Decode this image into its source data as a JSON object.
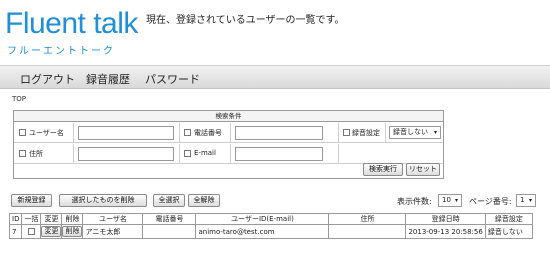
{
  "header": {
    "logo_main": "Fluent talk",
    "logo_sub": "フルーエントトーク",
    "description": "現在、登録されているユーザーの一覧です。"
  },
  "nav": {
    "logout": "ログアウト",
    "history": "録音履歴",
    "password": "パスワード"
  },
  "breadcrumb": "TOP",
  "search": {
    "title": "検索条件",
    "username_label": "ユーザー名",
    "phone_label": "電話番号",
    "recording_label": "録音設定",
    "recording_value": "録音しない",
    "address_label": "住所",
    "email_label": "E-mail",
    "search_button": "検索実行",
    "reset_button": "リセット"
  },
  "toolbar": {
    "new_button": "新規登録",
    "delete_selected_button": "選択したものを削除",
    "select_all_button": "全選択",
    "deselect_all_button": "全解除",
    "per_page_label": "表示件数:",
    "per_page_value": "10",
    "page_label": "ページ番号:",
    "page_value": "1"
  },
  "table": {
    "headers": {
      "id": "ID",
      "bulk": "一括",
      "edit": "変更",
      "delete": "削除",
      "username": "ユーザ名",
      "phone": "電話番号",
      "userid": "ユーザーID(E-mail)",
      "address": "住所",
      "registered": "登録日時",
      "recording": "録音設定"
    },
    "rows": [
      {
        "id": "7",
        "edit": "変更",
        "delete": "削除",
        "username": "アニモ太郎",
        "phone": "",
        "userid": "animo-taro@test.com",
        "address": "",
        "registered": "2013-09-13 20:58:56",
        "recording": "録音しない"
      }
    ]
  },
  "colors": {
    "brand_blue": "#1f8fd6",
    "nav_bg": "#e3e3e3"
  }
}
